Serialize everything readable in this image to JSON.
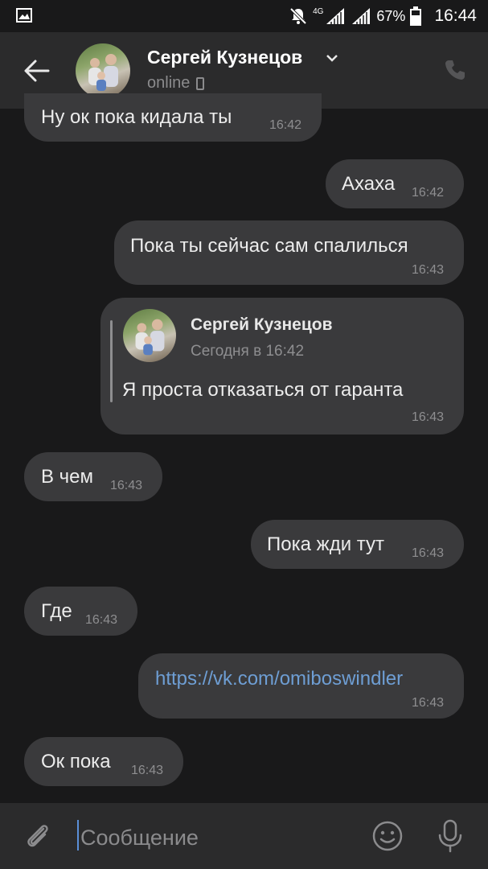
{
  "status_bar": {
    "network": "4G",
    "battery": "67%",
    "time": "16:44"
  },
  "header": {
    "contact_name": "Сергей Кузнецов",
    "status": "online"
  },
  "messages": [
    {
      "direction": "in",
      "text": "Ну ок пока кидала ты",
      "time": "16:42"
    },
    {
      "direction": "out",
      "text": "Ахаха",
      "time": "16:42"
    },
    {
      "direction": "out",
      "text": "Пока ты сейчас сам спалилься",
      "time": "16:43"
    },
    {
      "direction": "out",
      "reply_to": {
        "author": "Сергей Кузнецов",
        "date": "Сегодня в 16:42"
      },
      "text": "Я проста отказаться от гаранта",
      "time": "16:43"
    },
    {
      "direction": "in",
      "text": "В чем",
      "time": "16:43"
    },
    {
      "direction": "out",
      "text": "Пока жди тут",
      "time": "16:43"
    },
    {
      "direction": "in",
      "text": "Где",
      "time": "16:43"
    },
    {
      "direction": "out",
      "text": "https://vk.com/omiboswindler",
      "time": "16:43",
      "is_link": true
    },
    {
      "direction": "in",
      "text": "Ок пока",
      "time": "16:43"
    }
  ],
  "composer": {
    "placeholder": "Сообщение"
  },
  "colors": {
    "background": "#19191a",
    "bar": "#2b2b2c",
    "bubble": "#3a3a3c",
    "link": "#6e9ed4",
    "timestamp": "#8e8e90"
  },
  "icons": [
    "gallery-icon",
    "mute-icon",
    "signal-icon",
    "battery-icon",
    "back-arrow-icon",
    "chevron-down-icon",
    "mobile-icon",
    "phone-icon",
    "paperclip-icon",
    "emoji-icon",
    "microphone-icon"
  ]
}
